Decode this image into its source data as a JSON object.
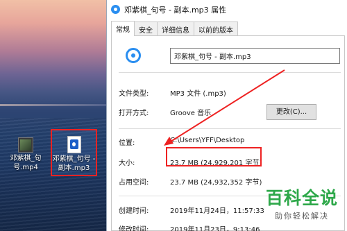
{
  "desktop": {
    "icons": [
      {
        "label": "邓紫棋_句号.mp4"
      },
      {
        "label": "邓紫棋_句号 - 副本.mp3"
      }
    ]
  },
  "window": {
    "title": "邓紫棋_句号 - 副本.mp3 属性",
    "tabs": [
      "常规",
      "安全",
      "详细信息",
      "以前的版本"
    ],
    "active_tab": "常规",
    "file_name": "邓紫棋_句号 - 副本.mp3",
    "fields": {
      "file_type_label": "文件类型:",
      "file_type_value": "MP3 文件 (.mp3)",
      "open_with_label": "打开方式:",
      "open_with_value": "Groove 音乐",
      "change_button": "更改(C)...",
      "location_label": "位置:",
      "location_value": "C:\\Users\\YFF\\Desktop",
      "size_label": "大小:",
      "size_value": "23.7 MB (24,929,201 字节)",
      "size_on_disk_label": "占用空间:",
      "size_on_disk_value": "23.7 MB (24,932,352 字节)",
      "created_label": "创建时间:",
      "created_value": "2019年11月24日，11:57:33",
      "modified_label": "修改时间:",
      "modified_value": "2019年11月23日，9:13:46"
    }
  },
  "watermark": {
    "title": "百科全说",
    "subtitle": "助你轻松解决"
  },
  "colors": {
    "annotation": "#ee2222",
    "watermark_green": "#2ea84a"
  }
}
